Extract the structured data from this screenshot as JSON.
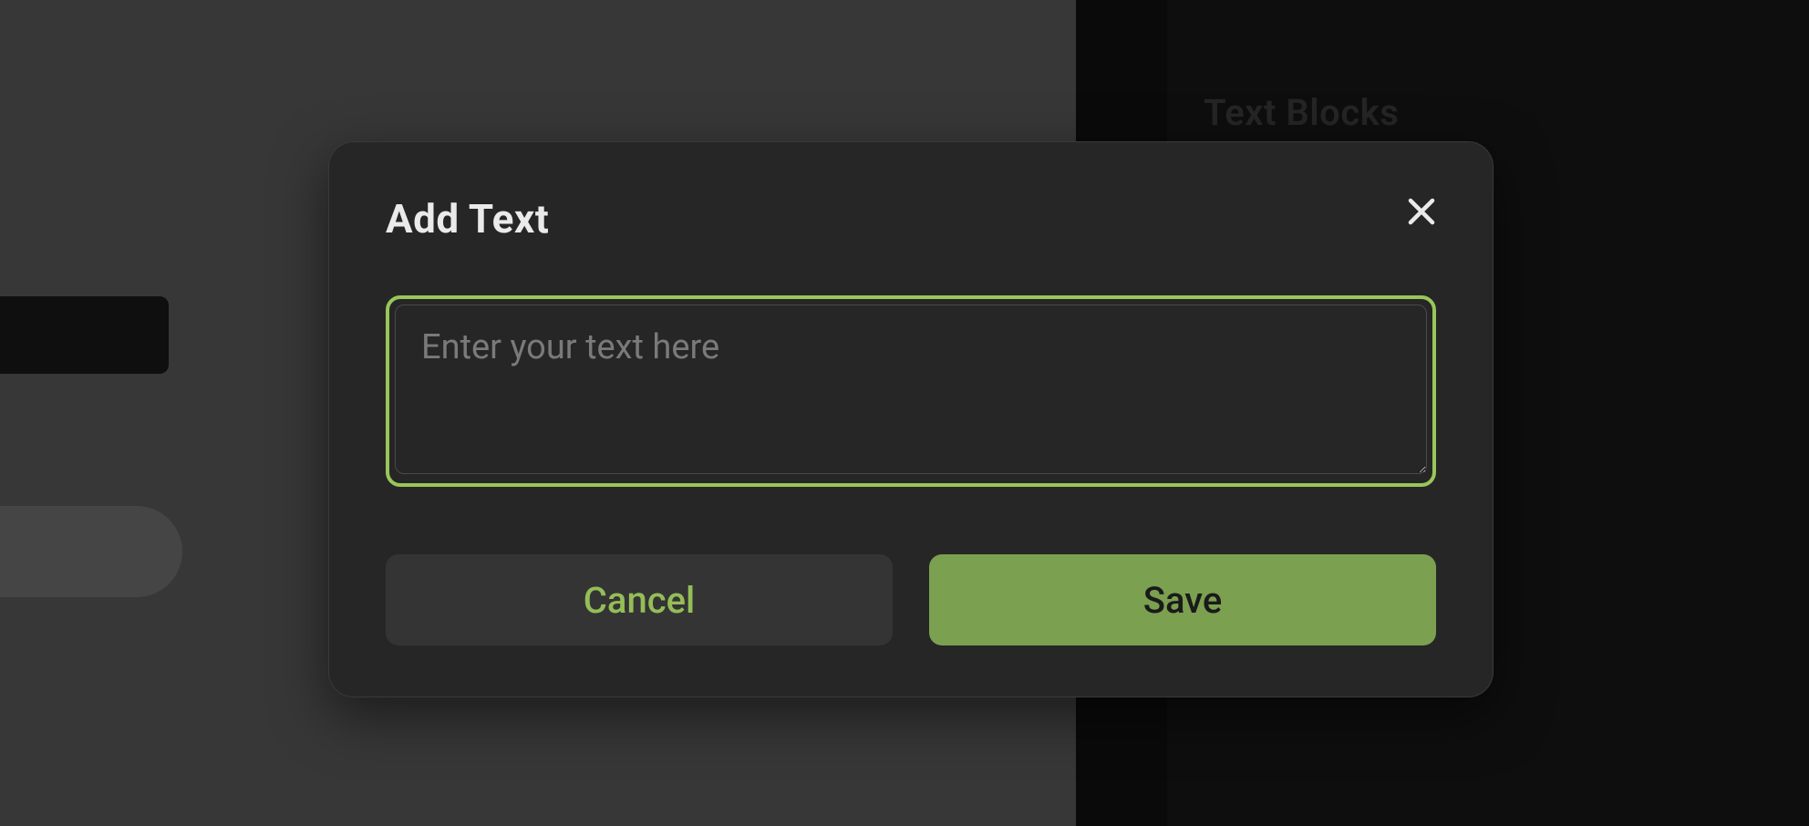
{
  "modal": {
    "title": "Add Text",
    "input_placeholder": "Enter your text here",
    "input_value": "",
    "cancel_label": "Cancel",
    "save_label": "Save"
  },
  "background": {
    "panel_heading": "Text Blocks"
  },
  "colors": {
    "accent": "#99c659",
    "save_bg": "#7ba050",
    "cancel_text": "#95bd58"
  }
}
